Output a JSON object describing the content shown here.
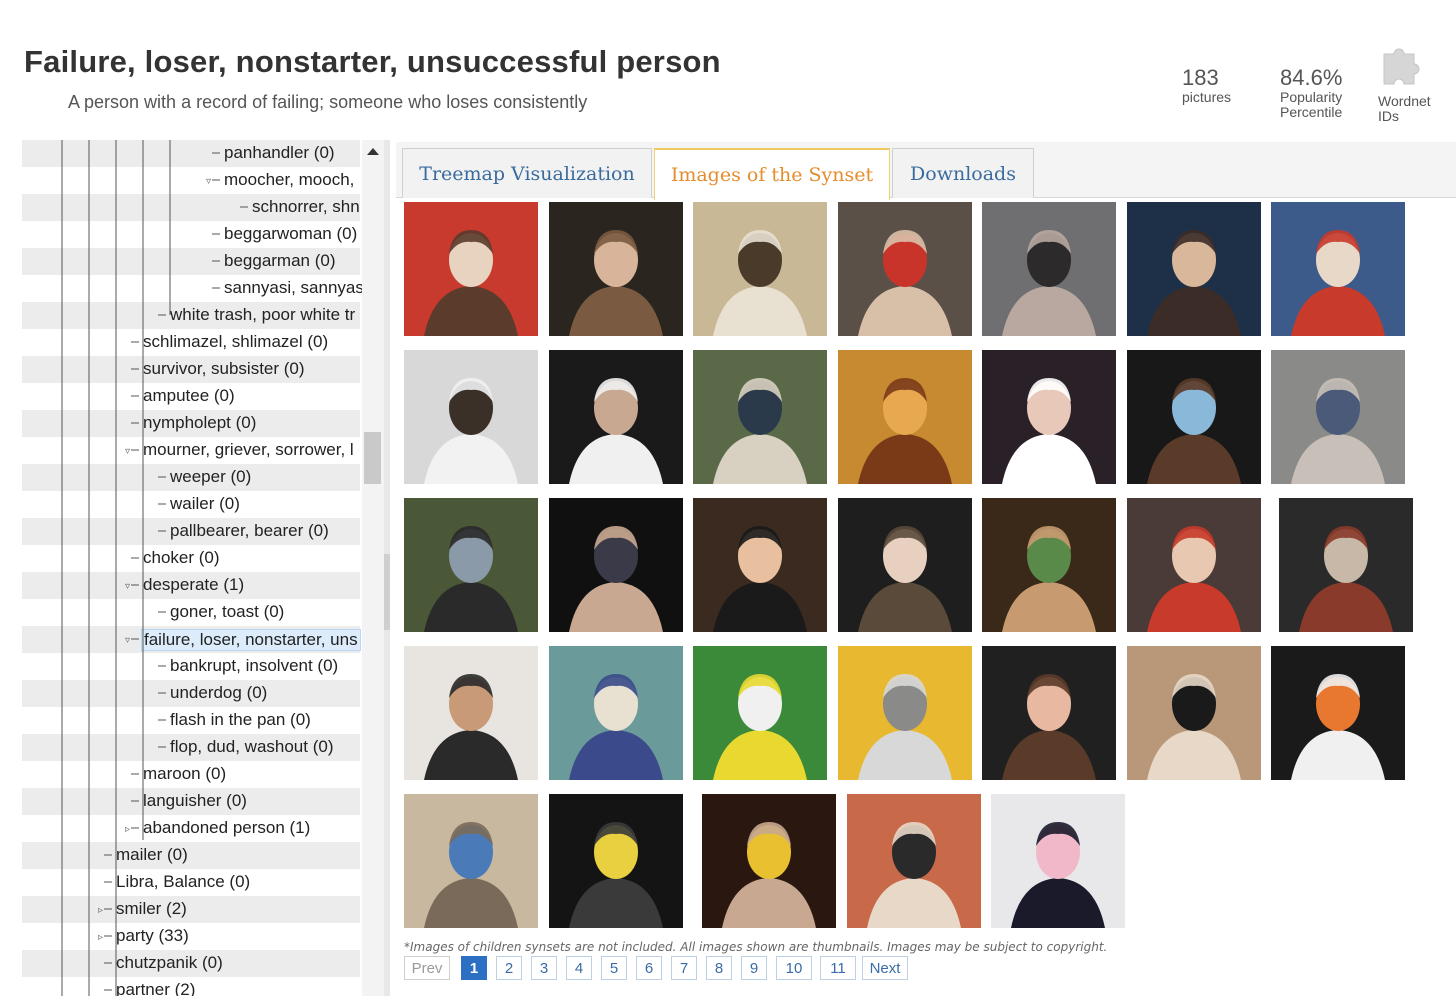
{
  "header": {
    "title": "Failure, loser, nonstarter, unsuccessful person",
    "subtitle": "A person with a record of failing; someone who loses consistently",
    "pictures_count": "183",
    "pictures_label": "pictures",
    "popularity_value": "84.6%",
    "popularity_label_1": "Popularity",
    "popularity_label_2": "Percentile",
    "wordnet_label_1": "Wordnet",
    "wordnet_label_2": "IDs",
    "wordnet_icon": "puzzle-piece-icon"
  },
  "tree": {
    "items": [
      {
        "label": "panhandler (0)",
        "level": 4
      },
      {
        "label": "moocher, mooch,",
        "level": 4,
        "expanded": true
      },
      {
        "label": "schnorrer, shn",
        "level": 5
      },
      {
        "label": "beggarwoman (0)",
        "level": 4
      },
      {
        "label": "beggarman (0)",
        "level": 4
      },
      {
        "label": "sannyasi, sannyas",
        "level": 4
      },
      {
        "label": "white trash, poor white tr",
        "level": 3
      },
      {
        "label": "schlimazel, shlimazel (0)",
        "level": 2
      },
      {
        "label": "survivor, subsister (0)",
        "level": 2
      },
      {
        "label": "amputee (0)",
        "level": 2
      },
      {
        "label": "nympholept (0)",
        "level": 2
      },
      {
        "label": "mourner, griever, sorrower, l",
        "level": 2,
        "expanded": true
      },
      {
        "label": "weeper (0)",
        "level": 3
      },
      {
        "label": "wailer (0)",
        "level": 3
      },
      {
        "label": "pallbearer, bearer (0)",
        "level": 3
      },
      {
        "label": "choker (0)",
        "level": 2
      },
      {
        "label": "desperate (1)",
        "level": 2,
        "expanded": true
      },
      {
        "label": "goner, toast (0)",
        "level": 3
      },
      {
        "label": "failure, loser, nonstarter, uns",
        "level": 2,
        "expanded": true,
        "selected": true
      },
      {
        "label": "bankrupt, insolvent (0)",
        "level": 3
      },
      {
        "label": "underdog (0)",
        "level": 3
      },
      {
        "label": "flash in the pan (0)",
        "level": 3
      },
      {
        "label": "flop, dud, washout (0)",
        "level": 3
      },
      {
        "label": "maroon (0)",
        "level": 2
      },
      {
        "label": "languisher (0)",
        "level": 2
      },
      {
        "label": "abandoned person (1)",
        "level": 2,
        "collapsed": true
      },
      {
        "label": "mailer (0)",
        "level": 1
      },
      {
        "label": "Libra, Balance (0)",
        "level": 1
      },
      {
        "label": "smiler (2)",
        "level": 1,
        "collapsed": true
      },
      {
        "label": "party (33)",
        "level": 1,
        "collapsed": true
      },
      {
        "label": "chutzpanik (0)",
        "level": 1
      },
      {
        "label": "partner (2)",
        "level": 1
      }
    ]
  },
  "tabs": [
    {
      "label": "Treemap Visualization",
      "active": false
    },
    {
      "label": "Images of the Synset",
      "active": true
    },
    {
      "label": "Downloads",
      "active": false
    }
  ],
  "gallery": {
    "thumbnails": [
      {
        "name": "boy-in-cap",
        "colors": [
          "#c83a2e",
          "#e8d3c0",
          "#5a3b2c"
        ]
      },
      {
        "name": "collage-people",
        "colors": [
          "#2b2520",
          "#d8b59a",
          "#7a5a40"
        ]
      },
      {
        "name": "indoor-event",
        "colors": [
          "#c8b895",
          "#4a3a2a",
          "#e8e0d0"
        ]
      },
      {
        "name": "crowd-red-shirt",
        "colors": [
          "#5a5048",
          "#c8332a",
          "#d8c0a8"
        ]
      },
      {
        "name": "street-group",
        "colors": [
          "#6f6f72",
          "#2c2a2a",
          "#b8a8a0"
        ]
      },
      {
        "name": "woman-hand",
        "colors": [
          "#1e3048",
          "#d9b79a",
          "#3b2c28"
        ]
      },
      {
        "name": "old-man-microphones",
        "colors": [
          "#3c5a8a",
          "#e8d8c8",
          "#c83a2a"
        ]
      },
      {
        "name": "desk-despair",
        "colors": [
          "#d8d8d8",
          "#3a3028",
          "#f2f2f2"
        ]
      },
      {
        "name": "bent-over-man",
        "colors": [
          "#1a1a1a",
          "#c8a890",
          "#f0f0f0"
        ]
      },
      {
        "name": "bikes-park",
        "colors": [
          "#5a6a48",
          "#2a3a4a",
          "#d8d0c0"
        ]
      },
      {
        "name": "hand-over-mouth",
        "colors": [
          "#c88a30",
          "#e8a850",
          "#7a3a18"
        ]
      },
      {
        "name": "hugging-girls",
        "colors": [
          "#2a2028",
          "#e8c8b8",
          "#ffffff"
        ]
      },
      {
        "name": "man-in-blue",
        "colors": [
          "#181818",
          "#8ab8d8",
          "#5a3a28"
        ]
      },
      {
        "name": "man-sitting-wall",
        "colors": [
          "#8a8a88",
          "#4a5a78",
          "#c8c0b8"
        ]
      },
      {
        "name": "man-bikes",
        "colors": [
          "#4a5838",
          "#8a9aa8",
          "#2a2a2a"
        ]
      },
      {
        "name": "sleeping-man",
        "colors": [
          "#101010",
          "#3a3a48",
          "#c8a890"
        ]
      },
      {
        "name": "party-group",
        "colors": [
          "#3a2a20",
          "#e8c0a0",
          "#1a1a1a"
        ]
      },
      {
        "name": "shocked-man",
        "colors": [
          "#1e1e1e",
          "#e8d0c0",
          "#5a4a3a"
        ]
      },
      {
        "name": "man-glasses-game",
        "colors": [
          "#3a2818",
          "#5a8a4a",
          "#c89a70"
        ]
      },
      {
        "name": "laughing-group",
        "colors": [
          "#4a3a38",
          "#e8c8b0",
          "#c83a2a"
        ]
      },
      {
        "name": "yawning-man",
        "colors": [
          "#2a2a2a",
          "#c8b8a8",
          "#8a3a2a"
        ]
      },
      {
        "name": "shirtless-man",
        "colors": [
          "#e8e4e0",
          "#c89a78",
          "#2a2a2a"
        ]
      },
      {
        "name": "blurry-room",
        "colors": [
          "#6a9a9a",
          "#e8e0d0",
          "#3a4a8a"
        ]
      },
      {
        "name": "soccer-players",
        "colors": [
          "#3a8a3a",
          "#f0f0f0",
          "#e8d830"
        ]
      },
      {
        "name": "sad-man-yellow",
        "colors": [
          "#e8b830",
          "#8a8a88",
          "#d8d8d8"
        ]
      },
      {
        "name": "face-closeup",
        "colors": [
          "#202020",
          "#e8b8a0",
          "#5a3a28"
        ]
      },
      {
        "name": "woman-silhouette",
        "colors": [
          "#b89878",
          "#1a1a1a",
          "#e8d8c8"
        ]
      },
      {
        "name": "man-orange-shirt",
        "colors": [
          "#1a1a1a",
          "#e87830",
          "#f0f0f0"
        ]
      },
      {
        "name": "thumbs-down-colosseum",
        "colors": [
          "#c8b8a0",
          "#4a7ab8",
          "#7a6a5a"
        ]
      },
      {
        "name": "man-backpack",
        "colors": [
          "#141414",
          "#e8d040",
          "#3a3a3a"
        ]
      },
      {
        "name": "bar-pair",
        "colors": [
          "#2a1810",
          "#e8c030",
          "#c8a890"
        ]
      },
      {
        "name": "woman-red-hair",
        "colors": [
          "#c86a4a",
          "#2a2a2a",
          "#e8d8c8"
        ]
      },
      {
        "name": "biggest-loser-shirt",
        "colors": [
          "#e8e8ea",
          "#f0b8c8",
          "#1a1a2a"
        ]
      }
    ]
  },
  "footer": {
    "note": "*Images of children synsets are not included. All images shown are thumbnails. Images may be subject to copyright.",
    "pagination": {
      "prev": "Prev",
      "pages": [
        "1",
        "2",
        "3",
        "4",
        "5",
        "6",
        "7",
        "8",
        "9",
        "10",
        "11"
      ],
      "current": "1",
      "next": "Next"
    }
  }
}
